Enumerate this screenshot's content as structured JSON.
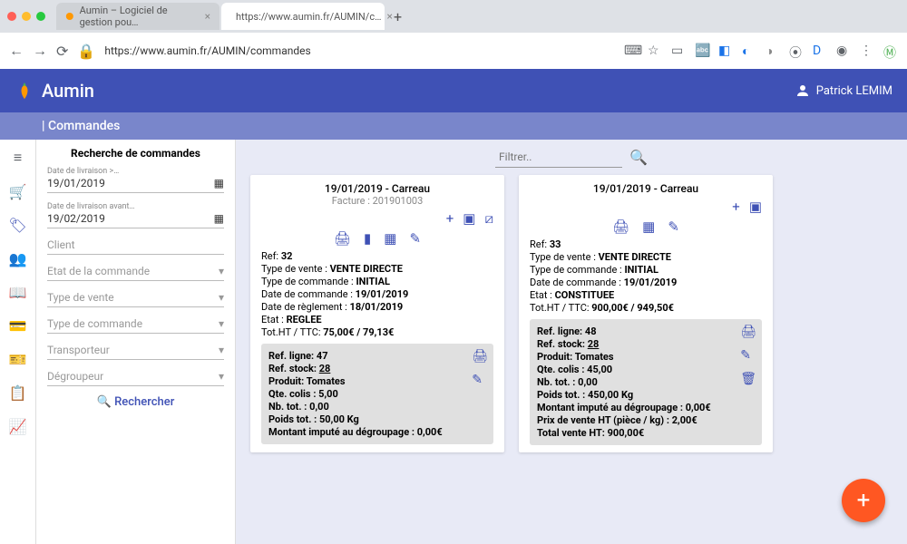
{
  "browser": {
    "tabs": [
      {
        "title": "Aumin – Logiciel de gestion pou…"
      },
      {
        "title": "https://www.aumin.fr/AUMIN/c…"
      }
    ],
    "url": "https://www.aumin.fr/AUMIN/commandes"
  },
  "header": {
    "brand": "Aumin",
    "user": "Patrick LEMIM"
  },
  "subheader": {
    "title": "| Commandes"
  },
  "rail": {
    "items": [
      "menu",
      "cart",
      "tag",
      "people",
      "book",
      "card",
      "ticket",
      "clipboard",
      "chart"
    ]
  },
  "search": {
    "title": "Recherche de commandes",
    "fields": {
      "date_from_label": "Date de livraison >…",
      "date_from": "19/01/2019",
      "date_to_label": "Date de livraison avant…",
      "date_to": "19/02/2019",
      "client_label": "Client",
      "etat_label": "Etat de la commande",
      "type_vente_label": "Type de vente",
      "type_commande_label": "Type de commande",
      "transporteur_label": "Transporteur",
      "degroupeur_label": "Dégroupeur"
    },
    "button": "Rechercher"
  },
  "filter": {
    "placeholder": "Filtrer.."
  },
  "cards": [
    {
      "title": "19/01/2019 - Carreau",
      "subtitle": "Facture : 201901003",
      "ref_label": "Ref: ",
      "ref": "32",
      "type_vente_label": "Type de vente : ",
      "type_vente": "VENTE DIRECTE",
      "type_commande_label": "Type de commande : ",
      "type_commande": "INITIAL",
      "date_commande_label": "Date de commande : ",
      "date_commande": "19/01/2019",
      "date_reglement_label": "Date de règlement : ",
      "date_reglement": "18/01/2019",
      "etat_label": "Etat : ",
      "etat": "REGLEE",
      "tot_label": "Tot.HT / TTC: ",
      "tot": "75,00€ / 79,13€",
      "line": {
        "ref_ligne_label": "Ref. ligne: ",
        "ref_ligne": "47",
        "ref_stock_label": "Ref. stock: ",
        "ref_stock": "28",
        "produit_label": "Produit: ",
        "produit": "Tomates",
        "qte_colis_label": "Qte. colis : ",
        "qte_colis": "5,00",
        "nb_tot_label": "Nb. tot. : ",
        "nb_tot": "0,00",
        "poids_tot_label": "Poids tot. : ",
        "poids_tot": "50,00 Kg",
        "montant_label": "Montant imputé au dégroupage : ",
        "montant": "0,00€"
      }
    },
    {
      "title": "19/01/2019 - Carreau",
      "subtitle": "",
      "ref_label": "Ref: ",
      "ref": "33",
      "type_vente_label": "Type de vente : ",
      "type_vente": "VENTE DIRECTE",
      "type_commande_label": "Type de commande : ",
      "type_commande": "INITIAL",
      "date_commande_label": "Date de commande : ",
      "date_commande": "19/01/2019",
      "etat_label": "Etat : ",
      "etat": "CONSTITUEE",
      "tot_label": "Tot.HT / TTC: ",
      "tot": "900,00€ / 949,50€",
      "line": {
        "ref_ligne_label": "Ref. ligne: ",
        "ref_ligne": "48",
        "ref_stock_label": "Ref. stock: ",
        "ref_stock": "28",
        "produit_label": "Produit: ",
        "produit": "Tomates",
        "qte_colis_label": "Qte. colis : ",
        "qte_colis": "45,00",
        "nb_tot_label": "Nb. tot. : ",
        "nb_tot": "0,00",
        "poids_tot_label": "Poids tot. : ",
        "poids_tot": "450,00 Kg",
        "montant_label": "Montant imputé au dégroupage : ",
        "montant": "0,00€",
        "prix_label": "Prix de vente HT (pièce / kg) : ",
        "prix": "2,00€",
        "total_label": "Total vente HT: ",
        "total": "900,00€"
      }
    }
  ]
}
